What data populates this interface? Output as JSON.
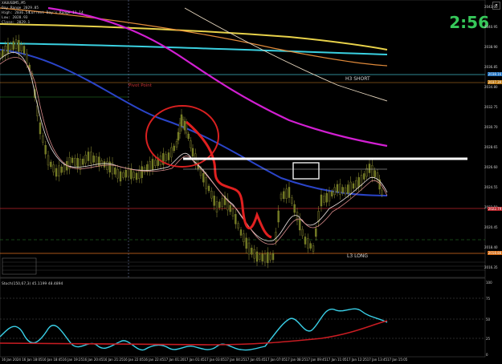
{
  "header": {
    "symbol_line": "XAUUSDM5,M5",
    "line2": "Day Range 2029.85",
    "line3": "High: 2036.54",
    "line4": "Low: 2028.93",
    "line5": "Close: 2029.1",
    "extra": "Current Day's Range 11.14"
  },
  "countdown": "2:56",
  "levels": {
    "h3_label": "H3 SHORT",
    "l3_label": "L3 LONG",
    "pivot_label": "Pivot Point"
  },
  "price_axis": [
    "2043.00",
    "2040.95",
    "2038.90",
    "2036.85",
    "2034.80",
    "2032.75",
    "2030.70",
    "2028.65",
    "2026.60",
    "2024.55",
    "2022.50",
    "2020.45",
    "2018.40",
    "2016.35"
  ],
  "price_badges": [
    {
      "text": "2038.16",
      "color": "#1a6fbf"
    },
    {
      "text": "2037.39",
      "color": "#c07b14"
    },
    {
      "text": "2022.79",
      "color": "#b8252b"
    },
    {
      "text": "2018.88",
      "color": "#d66a10"
    }
  ],
  "time_axis": [
    "16 Jan 2024",
    "16 Jan 18:05",
    "16 Jan 18:45",
    "16 Jan 19:25",
    "16 Jan 20:45",
    "16 Jan 21:25",
    "16 Jan 22:05",
    "16 Jan 22:45",
    "17 Jan 01:20",
    "17 Jan 01:45",
    "17 Jan 03:05",
    "17 Jan 04:25",
    "17 Jan 05:45",
    "17 Jan 07:05",
    "17 Jan 08:25",
    "17 Jan 09:45",
    "17 Jan 11:05",
    "17 Jan 12:25",
    "17 Jan 13:45",
    "17 Jan 15:05"
  ],
  "stoch": {
    "title": "Stoch(150,67,3) 45.1199 48.4894",
    "levels": [
      "100",
      "75",
      "50",
      "25",
      "0"
    ]
  },
  "colors": {
    "ma_yellow": "#e8d24a",
    "ma_cyan": "#3ad0e0",
    "ma_orange": "#e08a3a",
    "ma_white": "#e8d8c0",
    "ma_magenta": "#d21fd2",
    "ma_blue": "#2a44c8",
    "candles": "#8a8a30",
    "drawing_red": "#e02020"
  }
}
